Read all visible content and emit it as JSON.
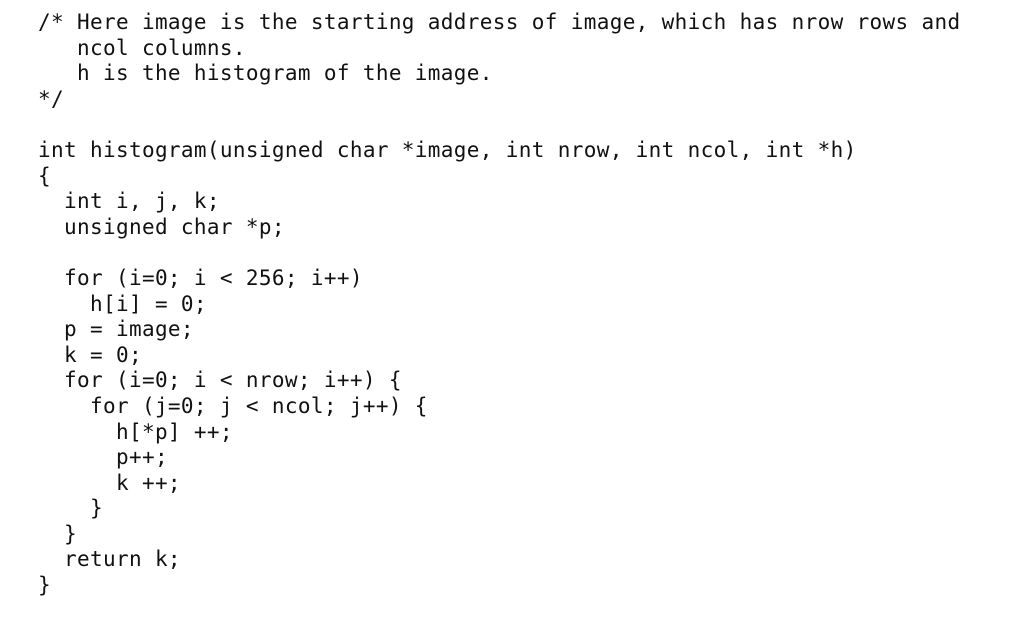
{
  "code": {
    "language": "c",
    "lines": [
      "/* Here image is the starting address of image, which has nrow rows and",
      "   ncol columns.",
      "   h is the histogram of the image.",
      "*/",
      "",
      "int histogram(unsigned char *image, int nrow, int ncol, int *h)",
      "{",
      "  int i, j, k;",
      "  unsigned char *p;",
      "",
      "  for (i=0; i < 256; i++)",
      "    h[i] = 0;",
      "  p = image;",
      "  k = 0;",
      "  for (i=0; i < nrow; i++) {",
      "    for (j=0; j < ncol; j++) {",
      "      h[*p] ++;",
      "      p++;",
      "      k ++;",
      "    }",
      "  }",
      "  return k;",
      "}"
    ]
  }
}
